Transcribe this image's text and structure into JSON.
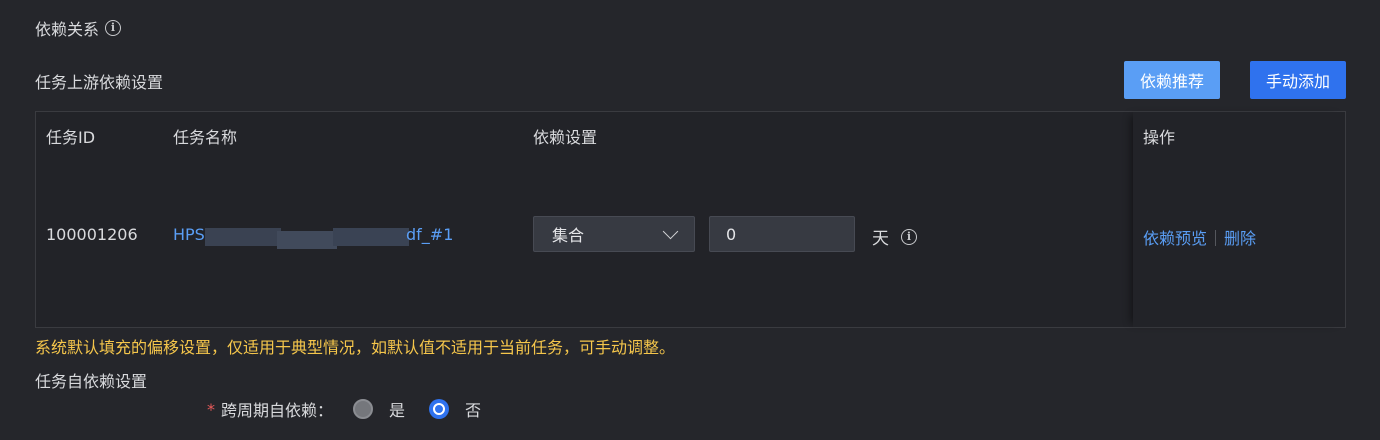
{
  "dependency": {
    "title": "依赖关系",
    "upstream_title": "任务上游依赖设置",
    "recommend_button": "依赖推荐",
    "manual_add_button": "手动添加",
    "table": {
      "columns": [
        "任务ID",
        "任务名称",
        "依赖设置",
        "操作"
      ],
      "rows": [
        {
          "task_id": "100001206",
          "task_name_prefix": "HPS",
          "task_name_suffix": "df_#1",
          "dep_mode": "集合",
          "offset_value": "0",
          "unit": "天",
          "actions": [
            "依赖预览",
            "删除"
          ]
        }
      ]
    },
    "hint": "系统默认填充的偏移设置，仅适用于典型情况，如默认值不适用于当前任务，可手动调整。",
    "self_title": "任务自依赖设置",
    "cross_cycle": {
      "required_mark": "*",
      "label": "跨周期自依赖：",
      "options": [
        "是",
        "否"
      ],
      "selected": "否"
    }
  },
  "colors": {
    "background": "#25262b",
    "link": "#5a9ef5",
    "primary": "#2f72ee",
    "warning": "#f5c64b",
    "required": "#e85a5a"
  }
}
